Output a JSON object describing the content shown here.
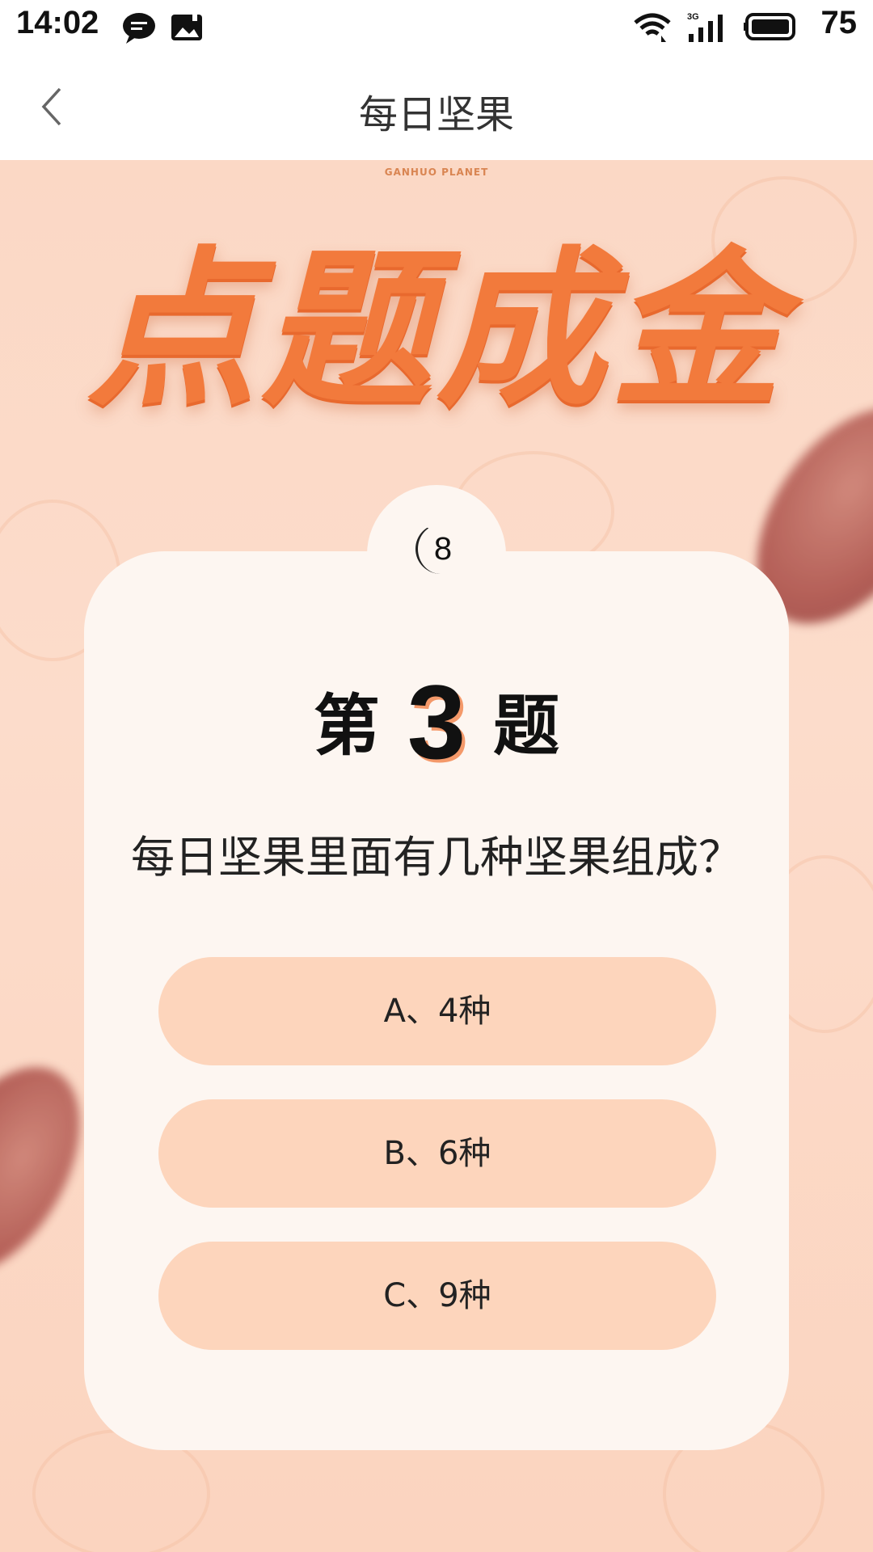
{
  "status_bar": {
    "time": "14:02",
    "battery": "75",
    "icons": [
      "chat-bubble-icon",
      "image-icon",
      "wifi-icon",
      "signal-3g-icon",
      "battery-icon"
    ]
  },
  "nav": {
    "title": "每日坚果",
    "back_icon": "chevron-left-icon"
  },
  "banner": {
    "brand": "GANHUO PLANET",
    "title": "点题成金"
  },
  "quiz": {
    "timer": "8",
    "heading_prefix": "第",
    "number": "3",
    "heading_suffix": "题",
    "question": "每日坚果里面有几种坚果组成？",
    "options": [
      {
        "label": "A、4种"
      },
      {
        "label": "B、6种"
      },
      {
        "label": "C、9种"
      }
    ]
  },
  "colors": {
    "background": "#fbd7c3",
    "card": "#fdf6f1",
    "option": "#fdd5bc",
    "accent": "#f27a3c"
  }
}
